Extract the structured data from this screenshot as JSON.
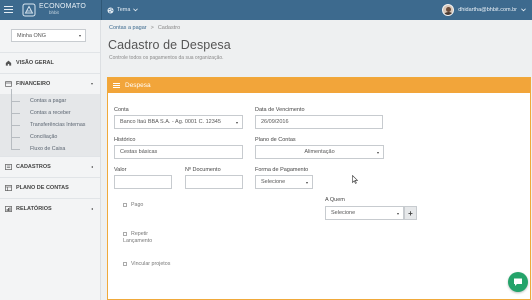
{
  "topbar": {
    "logo_name": "ECONOMATO",
    "logo_sub": "bhbit",
    "theme_label": "Tema",
    "user_name": "dhidartha@bhbit.com.br"
  },
  "sidebar": {
    "org_select": "Minha ONG",
    "items": [
      {
        "label": "VISÃO GERAL",
        "icon": "home-icon"
      },
      {
        "label": "FINANCEIRO",
        "icon": "financial-icon",
        "expanded": true,
        "children": [
          "Contas a pagar",
          "Contas a receber",
          "Transferências Internas",
          "Conciliação",
          "Fluxo de Caixa"
        ]
      },
      {
        "label": "CADASTROS",
        "icon": "register-icon"
      },
      {
        "label": "PLANO DE CONTAS",
        "icon": "accounts-plan-icon"
      },
      {
        "label": "RELATÓRIOS",
        "icon": "chart-icon"
      }
    ]
  },
  "breadcrumb": {
    "parent": "Contas a pagar",
    "separator": ">",
    "current": "Cadastro"
  },
  "page": {
    "title": "Cadastro de Despesa",
    "subtitle": "Controle todos os pagamentos da sua organização."
  },
  "panel": {
    "title": "Despesa",
    "header_color": "#f2a53a"
  },
  "form": {
    "conta_label": "Conta",
    "conta_value": "Banco Itaú BBA S.A. - Ag. 0001 C. 12345",
    "vencimento_label": "Data de Vencimento",
    "vencimento_value": "26/09/2016",
    "historico_label": "Histórico",
    "historico_value": "Cestas básicas",
    "plano_label": "Plano de Contas",
    "plano_value": "Alimentação",
    "valor_label": "Valor",
    "valor_value": "",
    "documento_label": "Nº Documento",
    "documento_value": "",
    "forma_label": "Forma de Pagamento",
    "forma_value": "Selecione",
    "pago_label": "Pago",
    "a_quem_label": "A Quem",
    "a_quem_value": "Selecione",
    "add_label": "+",
    "repetir_label_1": "Repetir",
    "repetir_label_2": "Lançamento",
    "vincular_label": "Vincular projetos"
  },
  "colors": {
    "topbar": "#3d6a8e",
    "panel_accent": "#f2a53a",
    "chat": "#24a36a"
  }
}
